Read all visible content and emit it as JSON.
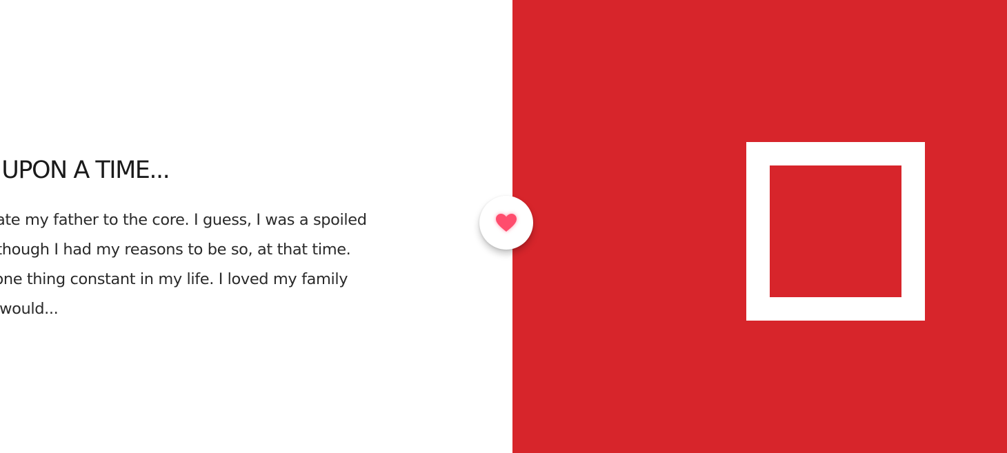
{
  "story": {
    "title": "E UPON A TIME...",
    "lines": [
      "o hate my father to the core. I guess, I was a spoiled",
      ". Although I had my reasons to be so, at that time.",
      "as one thing constant in my life. I loved my family",
      "kid would..."
    ]
  },
  "like_button": {
    "icon": "heart-icon",
    "color": "#ff4d6d"
  },
  "colors": {
    "accent": "#d7252b",
    "background": "#ffffff",
    "text": "#1a1a1a"
  }
}
